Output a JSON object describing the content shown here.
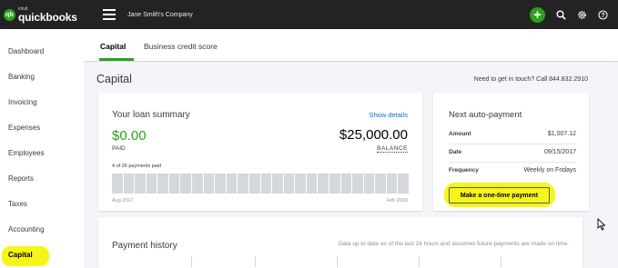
{
  "header": {
    "logo_small": "intuit",
    "logo_main": "quickbooks",
    "company_name": "Jane Smith's Company"
  },
  "sidebar": {
    "items": [
      {
        "label": "Dashboard"
      },
      {
        "label": "Banking"
      },
      {
        "label": "Invoicing"
      },
      {
        "label": "Expenses"
      },
      {
        "label": "Employees"
      },
      {
        "label": "Reports"
      },
      {
        "label": "Taxes"
      },
      {
        "label": "Accounting"
      },
      {
        "label": "Capital",
        "active": true
      }
    ]
  },
  "tabs": [
    {
      "label": "Capital",
      "active": true
    },
    {
      "label": "Business credit score"
    }
  ],
  "page": {
    "title": "Capital",
    "contact": "Need to get in touch? Call 844.832.2910"
  },
  "loan": {
    "title": "Your loan summary",
    "show_details": "Show details",
    "paid_amount": "$0.00",
    "paid_label": "PAID",
    "balance_amount": "$25,000.00",
    "balance_label": "BALANCE",
    "payments_count": "4 of 26 payments paid",
    "payments_paid": 4,
    "payments_total": 26,
    "range_start": "Aug 2017",
    "range_end": "Feb 2018"
  },
  "auto_payment": {
    "title": "Next auto-payment",
    "rows": [
      {
        "label": "Amount",
        "value": "$1,007.12"
      },
      {
        "label": "Date",
        "value": "09/15/2017"
      },
      {
        "label": "Frequency",
        "value": "Weekly on Fridays"
      }
    ],
    "button_label": "Make a one-time payment"
  },
  "history": {
    "title": "Payment history",
    "note": "Data up to date as of the last 24 hours and assumes future payments are made on time."
  },
  "colors": {
    "brand_green": "#2ca01c",
    "highlight": "#f5f51a",
    "link_blue": "#0077c5",
    "topbar": "#232323"
  },
  "icons": [
    "qb-logo-icon",
    "hamburger-icon",
    "plus-icon",
    "search-icon",
    "gear-icon",
    "help-icon",
    "cursor-icon"
  ]
}
